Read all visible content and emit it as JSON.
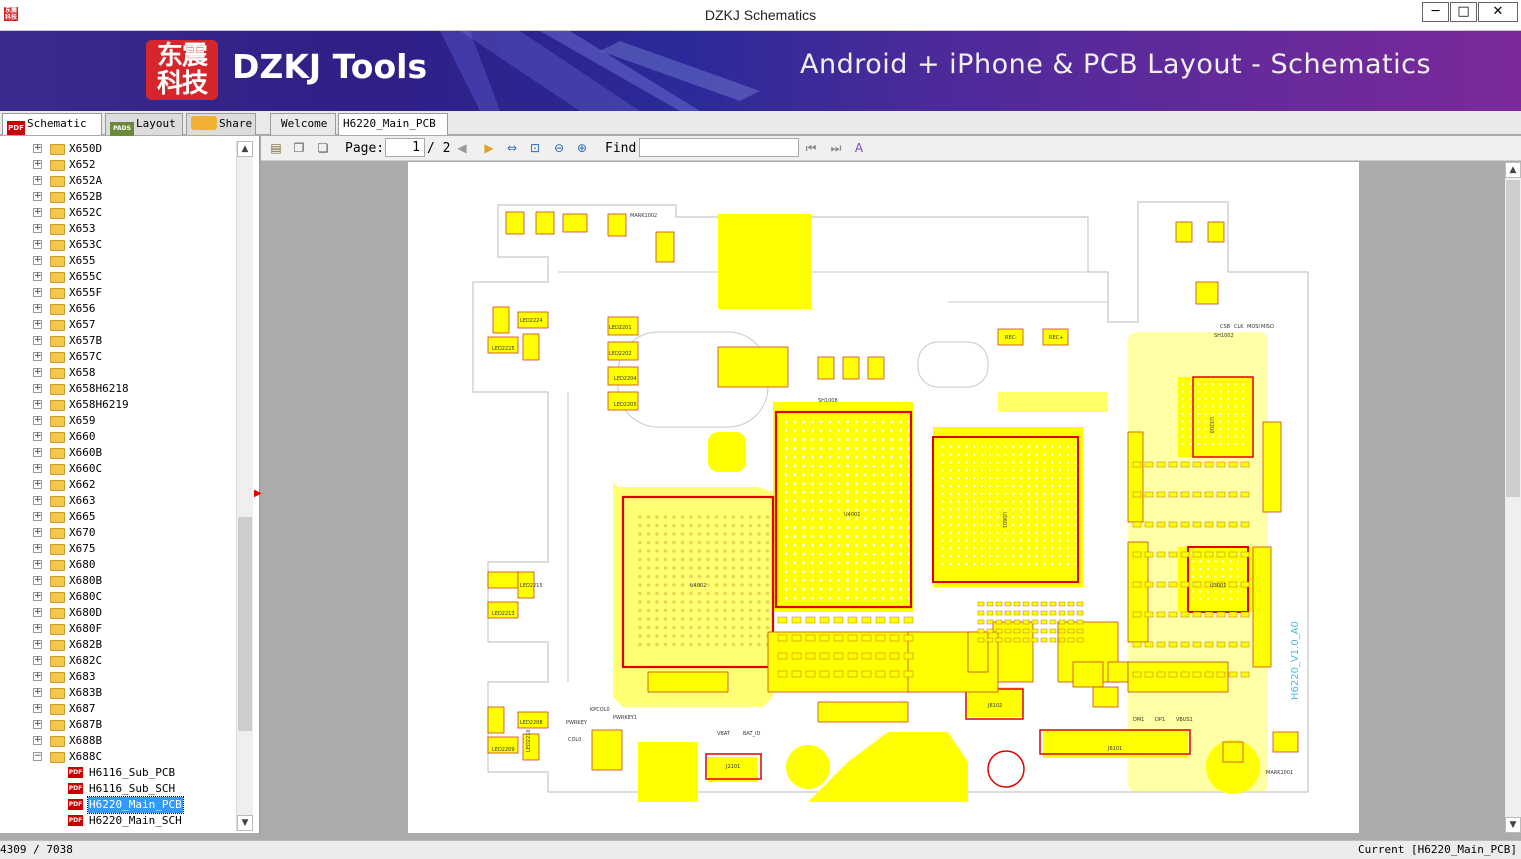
{
  "window": {
    "title": "DZKJ Schematics",
    "app_icon_text": "东震科技",
    "minimize": "─",
    "maximize": "□",
    "close": "✕"
  },
  "banner": {
    "logo_text": "东震\n科技",
    "brand": "DZKJ Tools",
    "tagline": "Android + iPhone & PCB Layout - Schematics"
  },
  "tabs": {
    "schematic": "Schematic",
    "layout": "Layout",
    "share": "Share",
    "welcome": "Welcome",
    "current_doc": "H6220_Main_PCB",
    "close_glyph": "✕",
    "pdf_badge": "PDF",
    "pads_badge": "PADS"
  },
  "tree": {
    "folders": [
      "X650D",
      "X652",
      "X652A",
      "X652B",
      "X652C",
      "X653",
      "X653C",
      "X655",
      "X655C",
      "X655F",
      "X656",
      "X657",
      "X657B",
      "X657C",
      "X658",
      "X658H6218",
      "X658H6219",
      "X659",
      "X660",
      "X660B",
      "X660C",
      "X662",
      "X663",
      "X665",
      "X670",
      "X675",
      "X680",
      "X680B",
      "X680C",
      "X680D",
      "X680F",
      "X682B",
      "X682C",
      "X683",
      "X683B",
      "X687",
      "X687B",
      "X688B",
      "X688C"
    ],
    "expanded_folder": "X688C",
    "files": [
      "H6116_Sub_PCB",
      "H6116_Sub_SCH",
      "H6220_Main_PCB",
      "H6220_Main_SCH"
    ],
    "selected_file": "H6220_Main_PCB",
    "expand_glyph": "+",
    "collapse_glyph": "−",
    "file_badge": "PDF"
  },
  "toolbar": {
    "page_label": "Page:",
    "page_current": "1",
    "page_total": "/ 2",
    "find_label": "Find:",
    "find_value": ""
  },
  "board": {
    "u4001": "U4001",
    "u4002": "U4002",
    "u0601": "U0601",
    "u3001": "U3001",
    "u3200": "U3200",
    "j6101": "J6101",
    "j6102": "J6102",
    "j2101": "J2101",
    "sh1002": "SH1002",
    "sh1008": "SH1008",
    "mark1001": "MARK1001",
    "mark1002": "MARK1002",
    "version": "H6220_V1.0_A0",
    "led2201": "LED2201",
    "led2202": "LED2202",
    "led2204": "LED2204",
    "led2205": "LED2205",
    "led2208": "LED2208",
    "led2209": "LED2209",
    "led2210": "LED2210",
    "led2213": "LED2213",
    "led2215": "LED2215",
    "led2224": "LED2224",
    "led2225": "LED2225",
    "vbat": "VBAT",
    "bat_id": "BAT_ID",
    "pwrkey": "PWRKEY",
    "pwrkey1": "PWRKEY1",
    "kpcol0": "KPCOL0",
    "col0": "COL0",
    "dm1": "DM1",
    "dp1": "DP1",
    "vbus1": "VBUS1",
    "rec_m": "REC-",
    "rec_p": "REC+",
    "csb": "CSB",
    "clk": "CLK",
    "mosi": "MOSI",
    "miso": "MISO"
  },
  "status": {
    "left": "4309 / 7038",
    "right": "Current [H6220_Main_PCB]"
  },
  "colors": {
    "pad": "#ffff00",
    "outline": "#c8c8c8",
    "ref_box": "#e00000",
    "label": "#333333",
    "version": "#40c0e0"
  }
}
